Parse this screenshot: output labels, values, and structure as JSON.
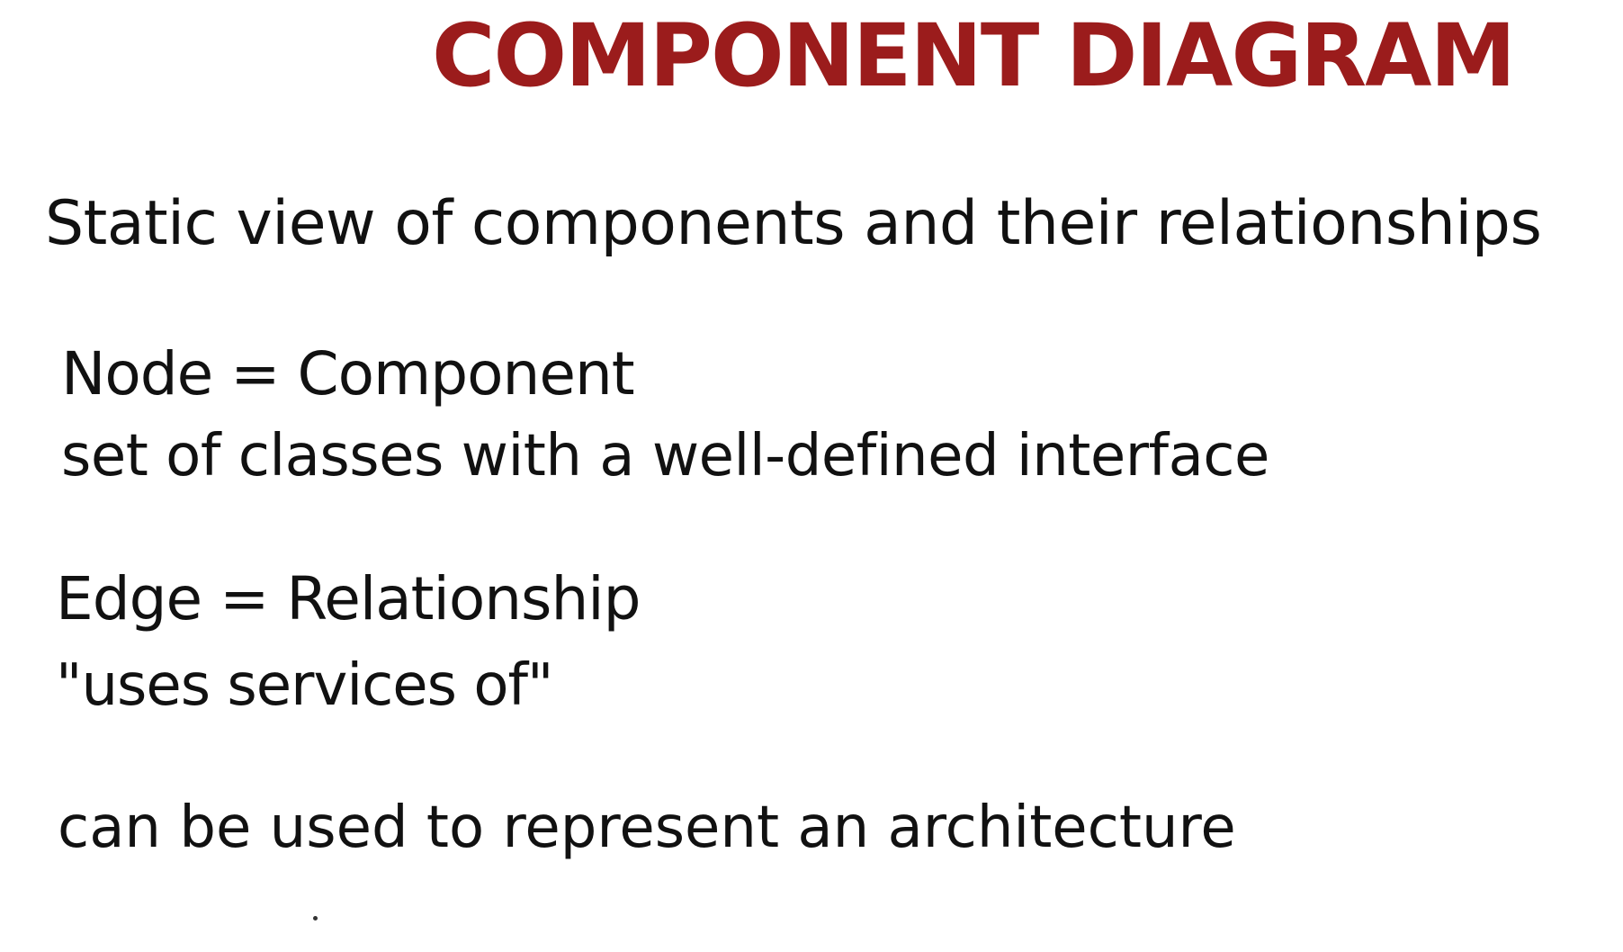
{
  "title": "COMPONENT DIAGRAM",
  "lines": {
    "static_view": "Static view of components and their relationships",
    "node": "Node = Component",
    "node_desc": "set of classes with a well-defined interface",
    "edge": "Edge = Relationship",
    "edge_desc": "\"uses services of\"",
    "usage": "can be used to represent an architecture"
  },
  "colors": {
    "title": "#9b1c1c",
    "text": "#111111",
    "background": "#ffffff"
  }
}
